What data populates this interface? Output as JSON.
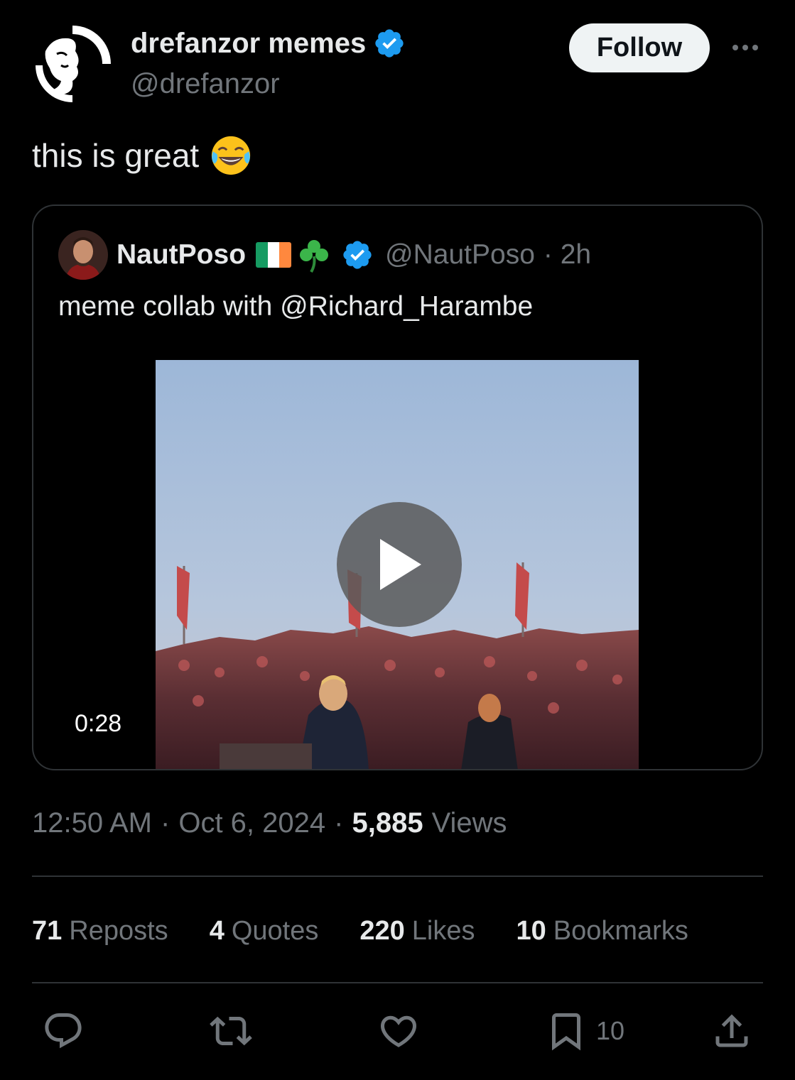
{
  "author": {
    "display_name": "drefanzor memes",
    "handle": "@drefanzor",
    "verified_icon": "verified-badge-icon",
    "follow_label": "Follow"
  },
  "tweet": {
    "text": "this is great",
    "emoji": "face-with-tears-of-joy-icon"
  },
  "quoted": {
    "display_name": "NautPoso",
    "badges": [
      "ireland-flag-icon",
      "shamrock-icon",
      "verified-badge-icon"
    ],
    "handle": "@NautPoso",
    "time": "· 2h",
    "text": "meme collab with @Richard_Harambe",
    "video_duration": "0:28"
  },
  "meta": {
    "time": "12:50 AM",
    "date": "Oct 6, 2024",
    "sep": "·",
    "views_count": "5,885",
    "views_label": "Views"
  },
  "stats": {
    "reposts_count": "71",
    "reposts_label": "Reposts",
    "quotes_count": "4",
    "quotes_label": "Quotes",
    "likes_count": "220",
    "likes_label": "Likes",
    "bookmarks_count": "10",
    "bookmarks_label": "Bookmarks"
  },
  "actions": {
    "bookmark_count": "10"
  },
  "colors": {
    "background": "#000000",
    "text_primary": "#e7e9ea",
    "text_secondary": "#71767b",
    "verified_blue": "#1d9bf0",
    "border": "#2f3336"
  }
}
